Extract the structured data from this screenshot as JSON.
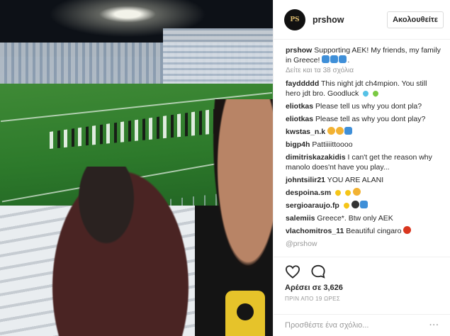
{
  "header": {
    "avatar_text": "PS",
    "username": "prshow",
    "follow_label": "Ακολουθείτε"
  },
  "caption": {
    "username": "prshow",
    "text": "Supporting AEK! My friends, my family in Greece! "
  },
  "view_comments": "Δείτε και τα 38 σχόλια",
  "comments": [
    {
      "user": "fayddddd",
      "text": "This night jdt ch4mpion. You still hero jdt bro. Goodluck"
    },
    {
      "user": "eliotkas",
      "text": "Please tell us why you dont pla?"
    },
    {
      "user": "eliotkas",
      "text": "Please tell as why you dont play?"
    },
    {
      "user": "kwstas_n.k",
      "text": ""
    },
    {
      "user": "bigp4h",
      "text": "Pattiiiittoooo"
    },
    {
      "user": "dimitriskazakidis",
      "text": "I can't get the reason why manolo does'nt have you play..."
    },
    {
      "user": "johntsilir21",
      "text": "YOU ARE ALANI"
    },
    {
      "user": "despoina.sm",
      "text": ""
    },
    {
      "user": "sergioaraujo.fp",
      "text": ""
    },
    {
      "user": "salemiis",
      "text": "Greece*. Btw only AEK"
    },
    {
      "user": "vlachomitros_11",
      "text": "Beautiful cingaro"
    }
  ],
  "partial_comment": "@prshow",
  "actions": {
    "like_icon": "heart-icon",
    "comment_icon": "comment-icon",
    "likes_text": "Αρέσει σε 3,626",
    "time_text": "ΠΡΙΝ ΑΠΟ 19 ΩΡΕΣ",
    "add_comment_placeholder": "Προσθέστε ένα σχόλιο...",
    "more_icon": "ellipsis-icon",
    "more_text": "···"
  },
  "colors": {
    "text": "#262626",
    "muted": "#999999",
    "border": "#efefef"
  }
}
